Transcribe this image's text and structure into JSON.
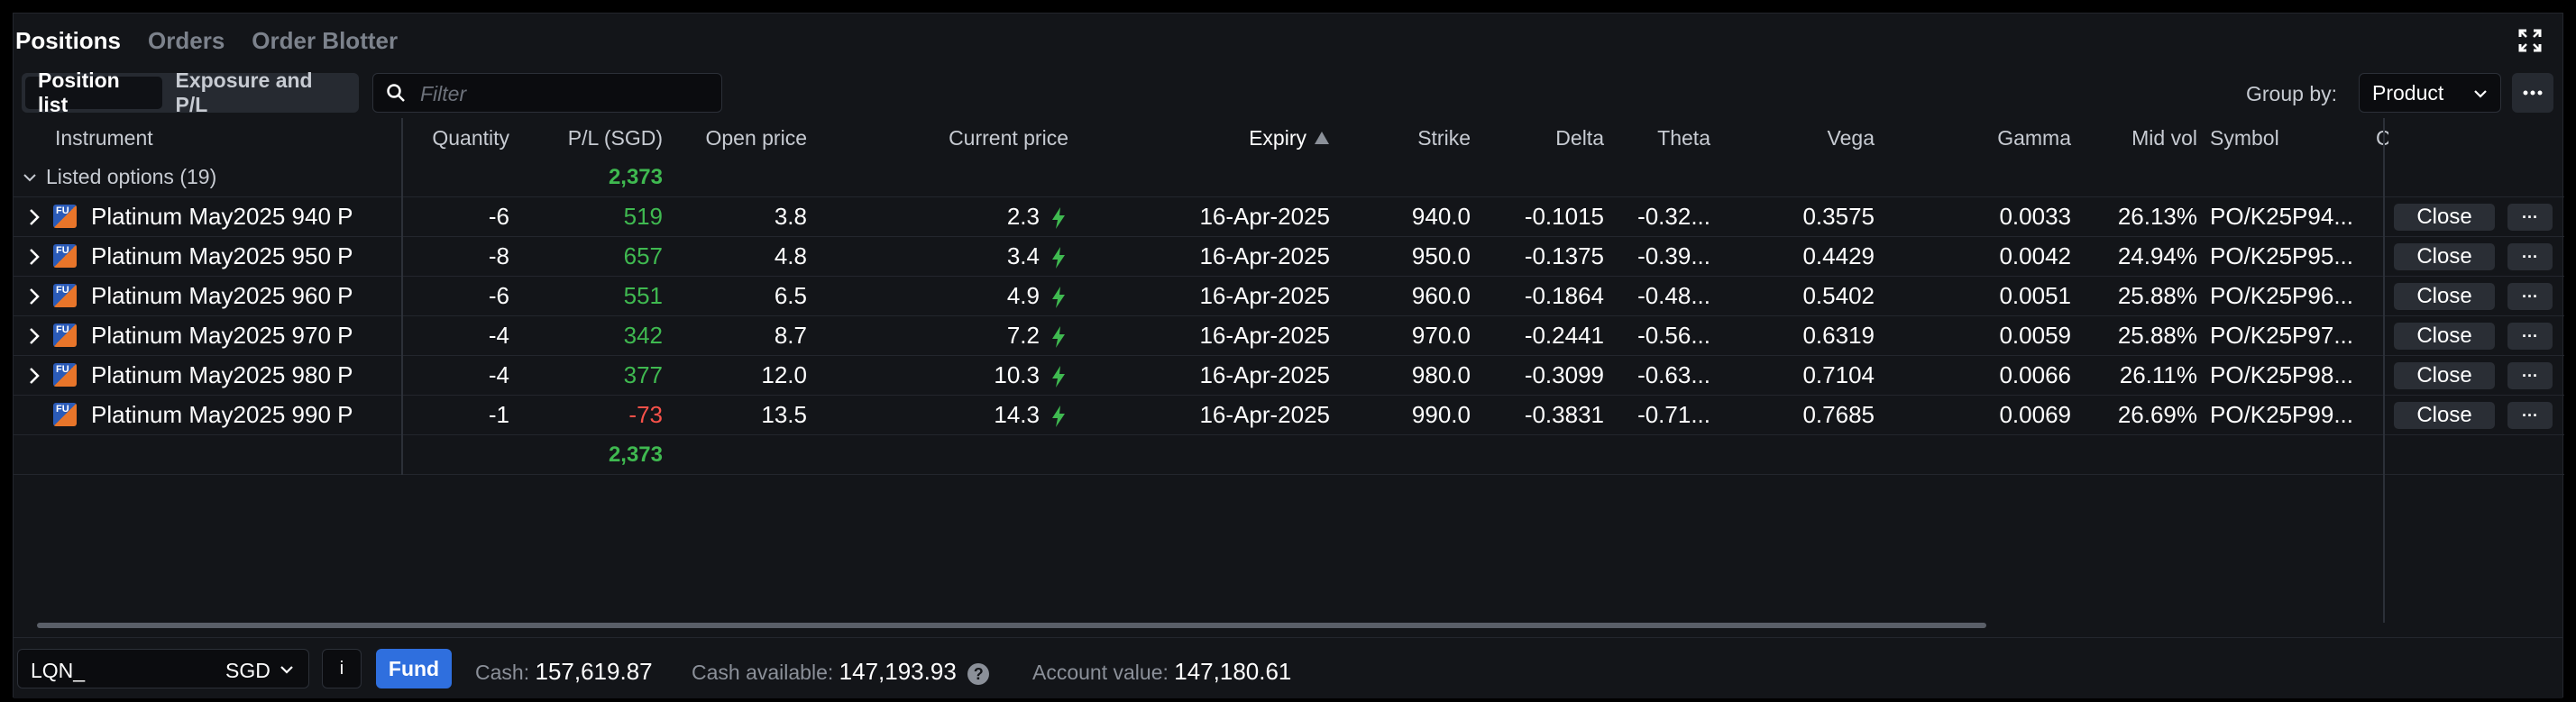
{
  "tabs": [
    "Positions",
    "Orders",
    "Order Blotter"
  ],
  "toolbar": {
    "segments": [
      "Position list",
      "Exposure and P/L"
    ],
    "filter_placeholder": "Filter",
    "group_by_label": "Group by:",
    "group_by_value": "Product"
  },
  "columns": {
    "instrument": "Instrument",
    "quantity": "Quantity",
    "pl": "P/L (SGD)",
    "open_price": "Open price",
    "current_price": "Current price",
    "expiry": "Expiry",
    "strike": "Strike",
    "delta": "Delta",
    "theta": "Theta",
    "vega": "Vega",
    "gamma": "Gamma",
    "mid_vol": "Mid vol",
    "symbol": "Symbol",
    "cut": "C"
  },
  "group": {
    "label": "Listed options (19)",
    "pl_total": "2,373"
  },
  "icon_label": "FU",
  "icon_sub": "O",
  "rows": [
    {
      "instrument": "Platinum May2025 940 P",
      "quantity": "-6",
      "pl": "519",
      "pl_sign": "pos",
      "open": "3.8",
      "current": "2.3",
      "expiry": "16-Apr-2025",
      "strike": "940.0",
      "delta": "-0.1015",
      "theta": "-0.32...",
      "vega": "0.3575",
      "gamma": "0.0033",
      "midvol": "26.13%",
      "symbol": "PO/K25P94...",
      "expandable": true
    },
    {
      "instrument": "Platinum May2025 950 P",
      "quantity": "-8",
      "pl": "657",
      "pl_sign": "pos",
      "open": "4.8",
      "current": "3.4",
      "expiry": "16-Apr-2025",
      "strike": "950.0",
      "delta": "-0.1375",
      "theta": "-0.39...",
      "vega": "0.4429",
      "gamma": "0.0042",
      "midvol": "24.94%",
      "symbol": "PO/K25P95...",
      "expandable": true
    },
    {
      "instrument": "Platinum May2025 960 P",
      "quantity": "-6",
      "pl": "551",
      "pl_sign": "pos",
      "open": "6.5",
      "current": "4.9",
      "expiry": "16-Apr-2025",
      "strike": "960.0",
      "delta": "-0.1864",
      "theta": "-0.48...",
      "vega": "0.5402",
      "gamma": "0.0051",
      "midvol": "25.88%",
      "symbol": "PO/K25P96...",
      "expandable": true
    },
    {
      "instrument": "Platinum May2025 970 P",
      "quantity": "-4",
      "pl": "342",
      "pl_sign": "pos",
      "open": "8.7",
      "current": "7.2",
      "expiry": "16-Apr-2025",
      "strike": "970.0",
      "delta": "-0.2441",
      "theta": "-0.56...",
      "vega": "0.6319",
      "gamma": "0.0059",
      "midvol": "25.88%",
      "symbol": "PO/K25P97...",
      "expandable": true
    },
    {
      "instrument": "Platinum May2025 980 P",
      "quantity": "-4",
      "pl": "377",
      "pl_sign": "pos",
      "open": "12.0",
      "current": "10.3",
      "expiry": "16-Apr-2025",
      "strike": "980.0",
      "delta": "-0.3099",
      "theta": "-0.63...",
      "vega": "0.7104",
      "gamma": "0.0066",
      "midvol": "26.11%",
      "symbol": "PO/K25P98...",
      "expandable": true
    },
    {
      "instrument": "Platinum May2025 990 P",
      "quantity": "-1",
      "pl": "-73",
      "pl_sign": "neg",
      "open": "13.5",
      "current": "14.3",
      "expiry": "16-Apr-2025",
      "strike": "990.0",
      "delta": "-0.3831",
      "theta": "-0.71...",
      "vega": "0.7685",
      "gamma": "0.0069",
      "midvol": "26.69%",
      "symbol": "PO/K25P99...",
      "expandable": false
    }
  ],
  "total_pl": "2,373",
  "row_actions": {
    "close": "Close",
    "more": "···"
  },
  "footer": {
    "account": "LQN_",
    "currency": "SGD",
    "info": "i",
    "fund": "Fund",
    "cash_label": "Cash:",
    "cash_value": "157,619.87",
    "cash_available_label": "Cash available:",
    "cash_available_value": "147,193.93",
    "help": "?",
    "account_value_label": "Account value:",
    "account_value_value": "147,180.61"
  },
  "colors": {
    "positive": "#3fb950",
    "negative": "#f85149",
    "accent": "#2f6fde"
  }
}
